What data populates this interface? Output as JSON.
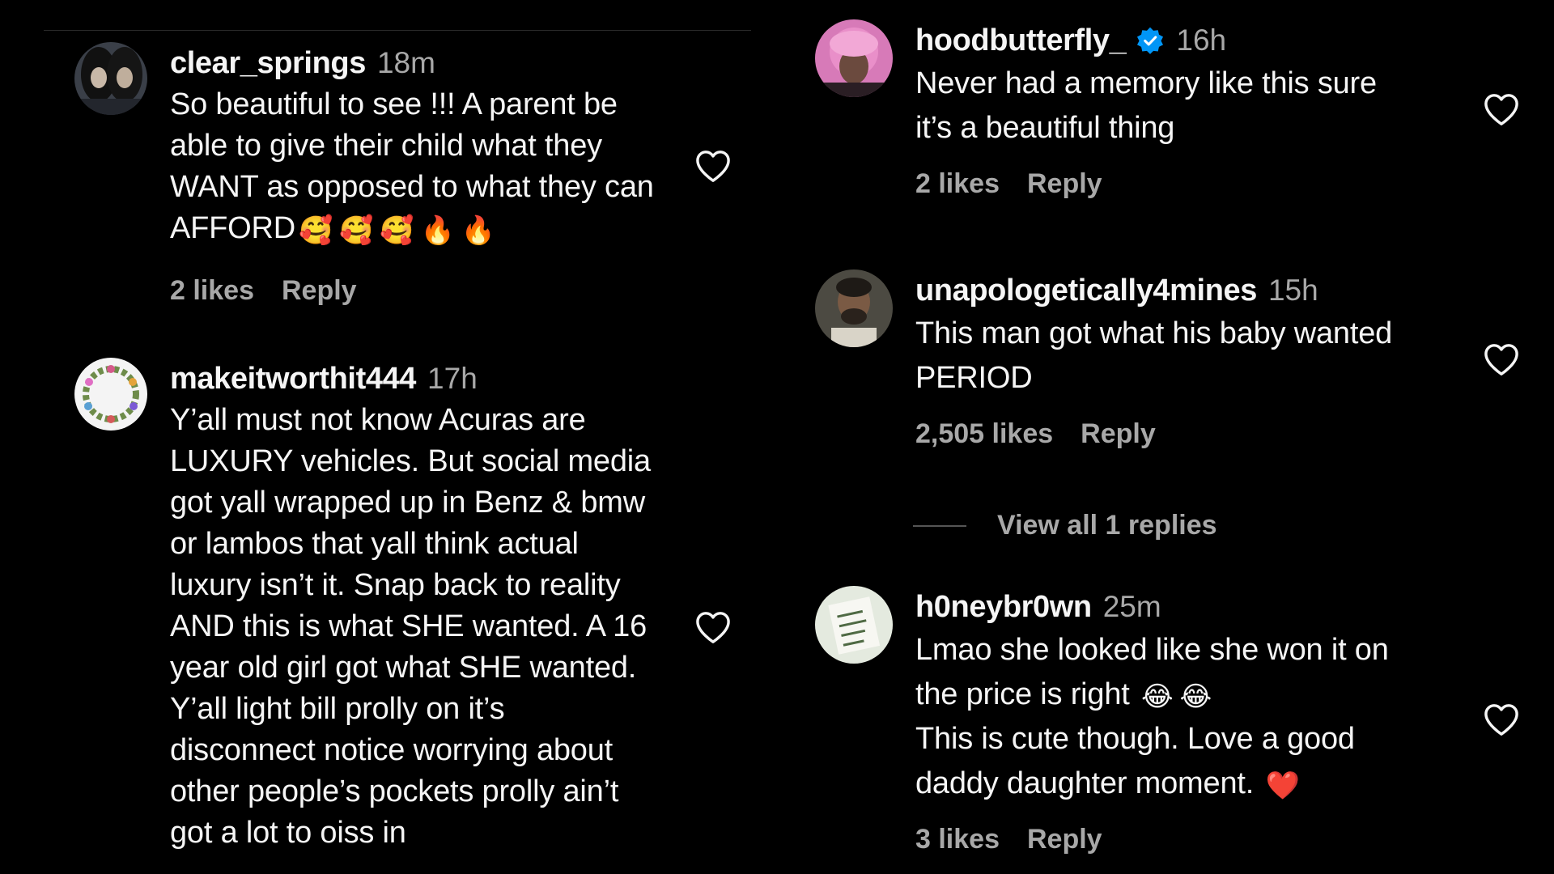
{
  "comments_left": [
    {
      "username": "clear_springs",
      "time": "18m",
      "text": "So beautiful to see !!! A parent be\nable to give their child what they\nWANT as opposed to what they can\nAFFORD",
      "emoji": [
        "🥰",
        "🥰",
        "🥰",
        "🔥",
        "🔥"
      ],
      "likes": "2 likes",
      "reply": "Reply"
    },
    {
      "username": "makeitworthit444",
      "time": "17h",
      "text": "Y’all must not know Acuras are\nLUXURY vehicles. But social media\ngot yall wrapped up in Benz & bmw\nor lambos that yall think actual\nluxury isn’t it. Snap back to reality\nAND this is what SHE wanted. A 16\nyear old girl got what SHE wanted.\nY’all light bill prolly on it’s\ndisconnect notice worrying about\nother people’s pockets prolly ain’t\ngot a lot to oiss in",
      "likes": "",
      "reply": ""
    }
  ],
  "comments_right": [
    {
      "username": "hoodbutterfly_",
      "verified": true,
      "time": "16h",
      "text": "Never had a memory like this sure\nit’s a beautiful thing",
      "likes": "2 likes",
      "reply": "Reply"
    },
    {
      "username": "unapologetically4mines",
      "time": "15h",
      "text": "This man got what his baby wanted\nPERIOD",
      "likes": "2,505 likes",
      "reply": "Reply"
    },
    {
      "username": "h0neybr0wn",
      "time": "25m",
      "text_line1": "Lmao she looked like she won it on",
      "text_line2": "the price is right",
      "text_line2_emoji": [
        "😂",
        "😂"
      ],
      "text_rest": "This is cute though. Love a good\ndaddy daughter moment.",
      "text_rest_emoji": [
        "❤️"
      ],
      "likes": "3 likes",
      "reply": "Reply"
    }
  ],
  "view_replies": "View all 1 replies",
  "icons": {
    "heart": "heart-icon",
    "verified": "verified-badge-icon"
  },
  "colors": {
    "background": "#000000",
    "primary_text": "#f5f5f5",
    "secondary_text": "#a8a8a8",
    "verified_blue": "#0095f6",
    "heart_emoji": "#ff2d55"
  }
}
